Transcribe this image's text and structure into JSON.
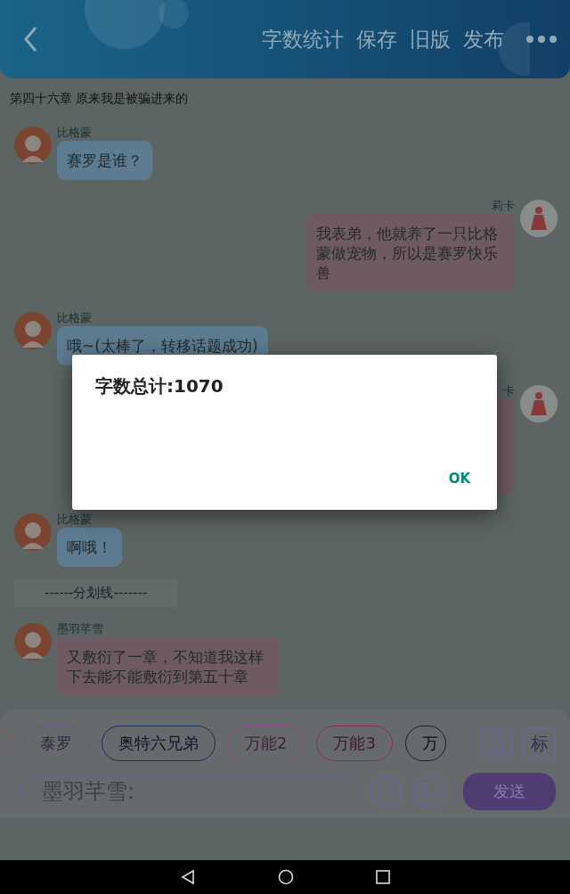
{
  "header": {
    "actions": [
      "字数统计",
      "保存",
      "旧版",
      "发布"
    ]
  },
  "chapter_title": "第四十六章 原来我是被骗进来的",
  "messages": [
    {
      "kind": "received",
      "name": "比格蒙",
      "text": "赛罗是谁？",
      "color": "#5d7b91"
    },
    {
      "kind": "sent",
      "name": "莉卡",
      "text": "我表弟，他就养了一只比格蒙做宠物，所以是赛罗快乐兽",
      "color": "#6e5a60"
    },
    {
      "kind": "received",
      "name": "比格蒙",
      "text": "哦~(太棒了，转移话题成功)",
      "color": "#5d7b91"
    },
    {
      "kind": "sent",
      "name": "卡",
      "color": "#6e5a60"
    },
    {
      "kind": "received",
      "name": "比格蒙",
      "text": "啊哦！",
      "color": "#5d7b91"
    },
    {
      "kind": "divider",
      "text": "------分划线-------"
    },
    {
      "kind": "received",
      "name": "墨羽芊雪",
      "text": "又敷衍了一章，不知道我这样下去能不能敷衍到第五十章",
      "color": "#6e5a60"
    }
  ],
  "role_chips": [
    {
      "color": "#8a5e48"
    },
    {
      "label": "泰罗",
      "color": "#6c5a86"
    },
    {
      "label": "奥特六兄弟",
      "color": "#1c2c5c"
    },
    {
      "label": "万能2",
      "color": "#8d4e86"
    },
    {
      "label": "万能3",
      "color": "#8e2e4e"
    },
    {
      "label": "万",
      "color": "#222222"
    }
  ],
  "tag_button": "标",
  "input": {
    "placeholder": "墨羽芊雪:"
  },
  "send_button": "发送",
  "dialog": {
    "title": "字数总计:1070",
    "button": "OK"
  }
}
